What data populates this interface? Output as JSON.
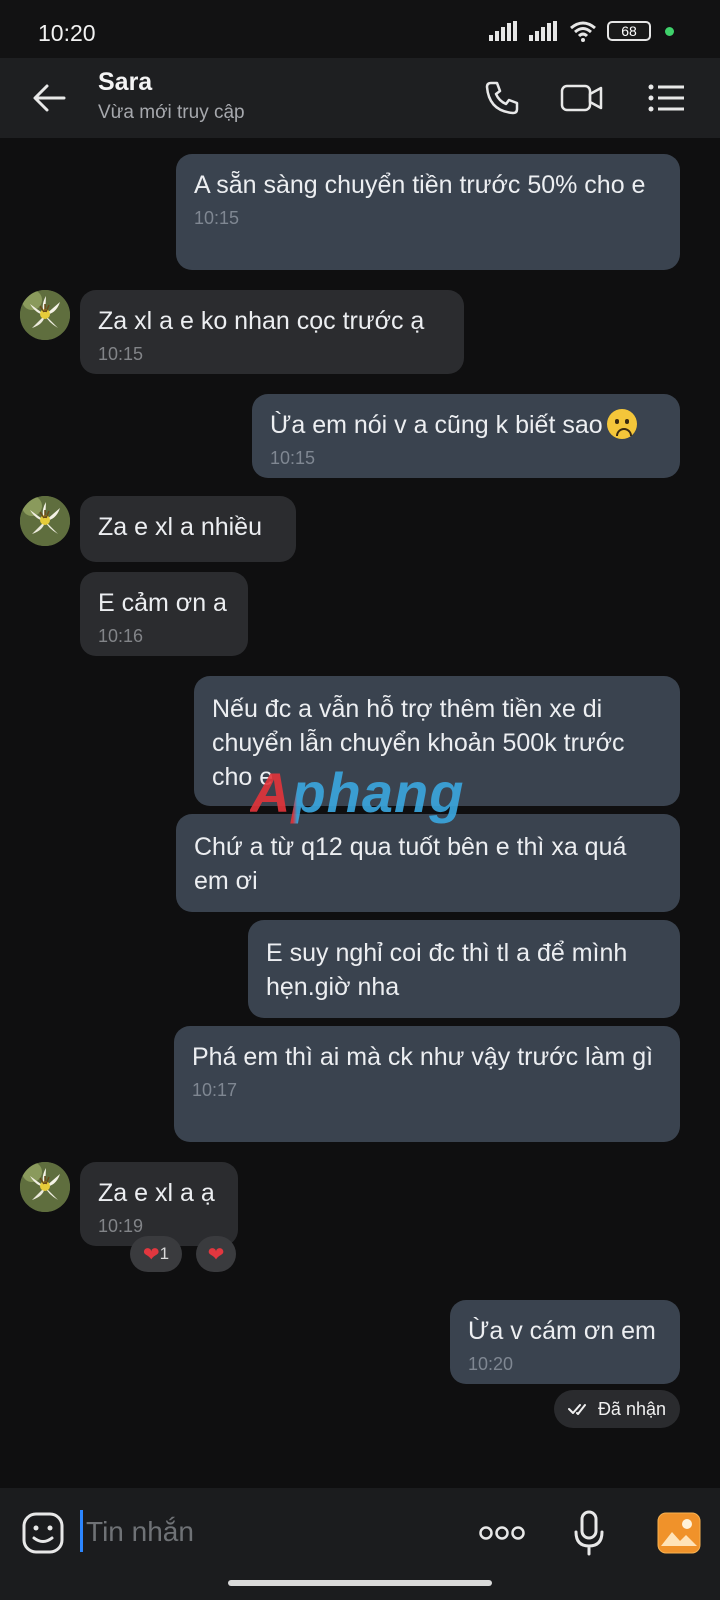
{
  "status_bar": {
    "time": "10:20",
    "battery": "68"
  },
  "header": {
    "contact_name": "Sara",
    "contact_status": "Vừa mới truy cập",
    "icons": [
      "back-arrow-icon",
      "phone-icon",
      "video-call-icon",
      "menu-list-icon"
    ]
  },
  "messages": [
    {
      "dir": "out",
      "text": "A sẵn sàng chuyển tiền trước 50% cho e",
      "time": "10:15"
    },
    {
      "dir": "in",
      "text": "Za xl a e ko nhan cọc trước ạ",
      "time": "10:15"
    },
    {
      "dir": "out",
      "text": "Ừa em nói v a cũng k biết sao",
      "time": "10:15",
      "emoji": "sad-face"
    },
    {
      "dir": "in",
      "text": "Za e xl a nhiều"
    },
    {
      "dir": "in",
      "text": "E cảm ơn a",
      "time": "10:16"
    },
    {
      "dir": "out",
      "text": "Nếu đc a vẫn hỗ trợ thêm tiền xe di chuyển lẫn chuyển khoản 500k trước cho e"
    },
    {
      "dir": "out",
      "text": "Chứ a từ q12 qua tuốt bên e thì xa quá em ơi"
    },
    {
      "dir": "out",
      "text": "E suy nghỉ coi đc thì tl a để mình hẹn.giờ nha"
    },
    {
      "dir": "out",
      "text": "Phá em thì ai mà ck như vậy trước làm gì",
      "time": "10:17"
    },
    {
      "dir": "in",
      "text": "Za e xl a ạ",
      "time": "10:19"
    },
    {
      "dir": "out",
      "text": "Ừa v cám ơn em",
      "time": "10:20"
    }
  ],
  "reactions": {
    "count": "1",
    "heart": "❤"
  },
  "delivery_status": "Đã nhận",
  "watermark": "Aphang",
  "input": {
    "placeholder": "Tin nhắn"
  },
  "colors": {
    "outgoing_bubble": "#3a434f",
    "incoming_bubble": "#2b2c2f",
    "background": "#0f0f10",
    "accent": "#2c86ff"
  }
}
